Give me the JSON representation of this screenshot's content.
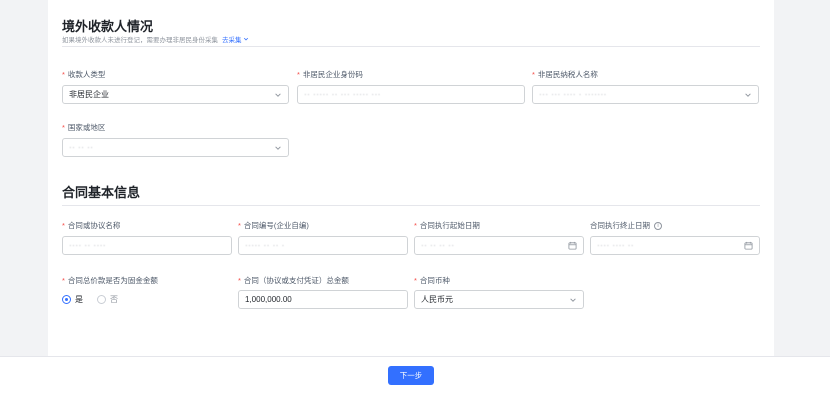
{
  "section1": {
    "title": "境外收款人情况",
    "subtitle": "如果境外收款人未进行登记，需要办理非居民身份采集",
    "subtitle_link": "去采集"
  },
  "payee_type": {
    "label": "收款人类型",
    "value": "非居民企业"
  },
  "enterprise_id": {
    "label": "非居民企业身份码",
    "value": "·· ····· ·· ··· ····· ···"
  },
  "taxpayer_name": {
    "label": "非居民纳税人名称",
    "value": "··· ··· ···· · ·······"
  },
  "country": {
    "label": "国家或地区",
    "value": "·· ·· ··"
  },
  "section2": {
    "title": "合同基本信息"
  },
  "contract_name": {
    "label": "合同或协议名称",
    "value": "···· ·· ····"
  },
  "contract_no": {
    "label": "合同编号(企业自编)",
    "value": "····· ·· ·· ·"
  },
  "start_date": {
    "label": "合同执行起始日期",
    "value": "·· ·· ·· ··"
  },
  "end_date": {
    "label": "合同执行终止日期",
    "value": "···· ···· ··"
  },
  "foreign_amount": {
    "label": "合同总价款是否为固金金额",
    "options": [
      "是",
      "否"
    ],
    "selected": "是"
  },
  "total_amount": {
    "label": "合同（协议或支付凭证）总金额",
    "value": "1,000,000.00"
  },
  "currency": {
    "label": "合同币种",
    "value": "人民币元"
  },
  "footer": {
    "next_label": "下一步"
  },
  "colors": {
    "primary": "#3370ff",
    "required": "#f54a45"
  }
}
